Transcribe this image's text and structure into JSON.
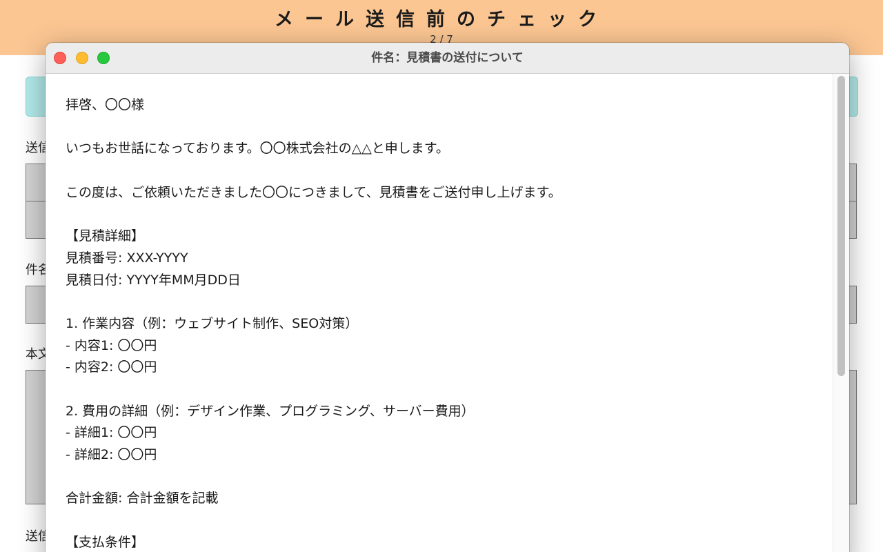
{
  "app": {
    "title": "メール送信前のチェック",
    "progress": "2 / 7",
    "labels": {
      "recipient": "送信",
      "subject": "件名",
      "body": "本文",
      "send": "送信"
    }
  },
  "dialog": {
    "title": "件名：見積書の送付について",
    "body_lines": [
      "拝啓、〇〇様",
      "",
      "いつもお世話になっております。〇〇株式会社の△△と申します。",
      "",
      "この度は、ご依頼いただきました〇〇につきまして、見積書をご送付申し上げます。",
      "",
      "【見積詳細】",
      "見積番号: XXX-YYYY",
      "見積日付: YYYY年MM月DD日",
      "",
      "1. 作業内容（例：ウェブサイト制作、SEO対策）",
      "- 内容1: 〇〇円",
      "- 内容2: 〇〇円",
      "",
      "2. 費用の詳細（例：デザイン作業、プログラミング、サーバー費用）",
      "- 詳細1: 〇〇円",
      "- 詳細2: 〇〇円",
      "",
      "合計金額: 合計金額を記載",
      "",
      "【支払条件】"
    ]
  }
}
